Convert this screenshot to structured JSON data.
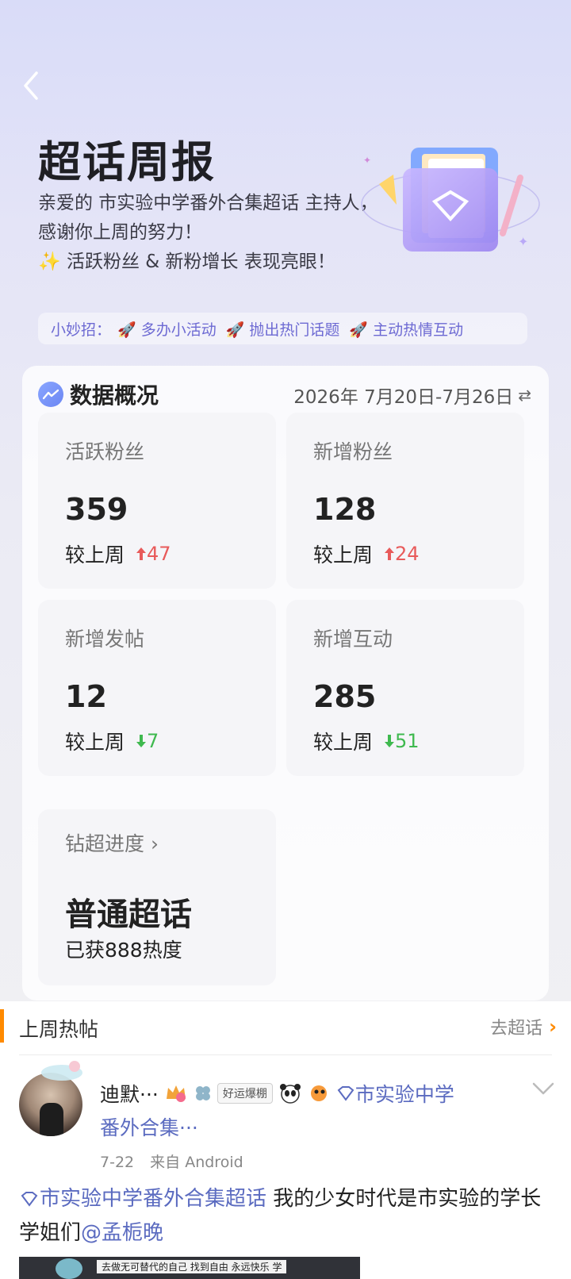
{
  "header": {
    "title": "超话周报",
    "desc_line1": "亲爱的 市实验中学番外合集超话 主持人，感谢你上周的努力！",
    "desc_line2": "✨ 活跃粉丝 & 新粉增长 表现亮眼！",
    "tips_label": "小妙招：",
    "tips": [
      "🚀 多办小活动",
      "🚀 抛出热门话题",
      "🚀 主动热情互动"
    ]
  },
  "overview": {
    "title": "数据概况",
    "date_range": "2026年 7月20日-7月26日",
    "compare_label": "较上周",
    "stats": [
      {
        "label": "活跃粉丝",
        "value": "359",
        "delta": "47",
        "trend": "up"
      },
      {
        "label": "新增粉丝",
        "value": "128",
        "delta": "24",
        "trend": "up"
      },
      {
        "label": "新增发帖",
        "value": "12",
        "delta": "7",
        "trend": "down"
      },
      {
        "label": "新增互动",
        "value": "285",
        "delta": "51",
        "trend": "down"
      }
    ],
    "progress": {
      "label": "钻超进度 ›",
      "level": "普通超话",
      "heat": "已获888热度"
    }
  },
  "hot_posts": {
    "title": "上周热帖",
    "goto_label": "去超话",
    "post": {
      "username": "迪默···",
      "luck_badge": "好运爆棚",
      "topic_inline": "市实验中学",
      "topic_cont": "番外合集···",
      "date": "7-22",
      "source": "来自 Android",
      "tag": "市实验中学番外合集超话",
      "text": " 我的少女时代是市实验的学长学姐们",
      "mention": "@孟栀晚",
      "image_caption": "去做无可替代的自己 找到自由 永远快乐 学"
    }
  },
  "colors": {
    "up": "#e85a5a",
    "down": "#3fb94f",
    "link": "#5b6bc0",
    "accent": "#ff8a00",
    "tips": "#6d6ad3"
  },
  "icons": [
    "back-arrow-icon",
    "folder-illustration-icon",
    "trend-chart-icon",
    "swap-icon",
    "arrow-up-icon",
    "arrow-down-icon",
    "crown-badge-icon",
    "clover-icon",
    "panda-icon",
    "fish-icon",
    "diamond-icon",
    "chevron-down-icon",
    "chevron-right-icon"
  ]
}
